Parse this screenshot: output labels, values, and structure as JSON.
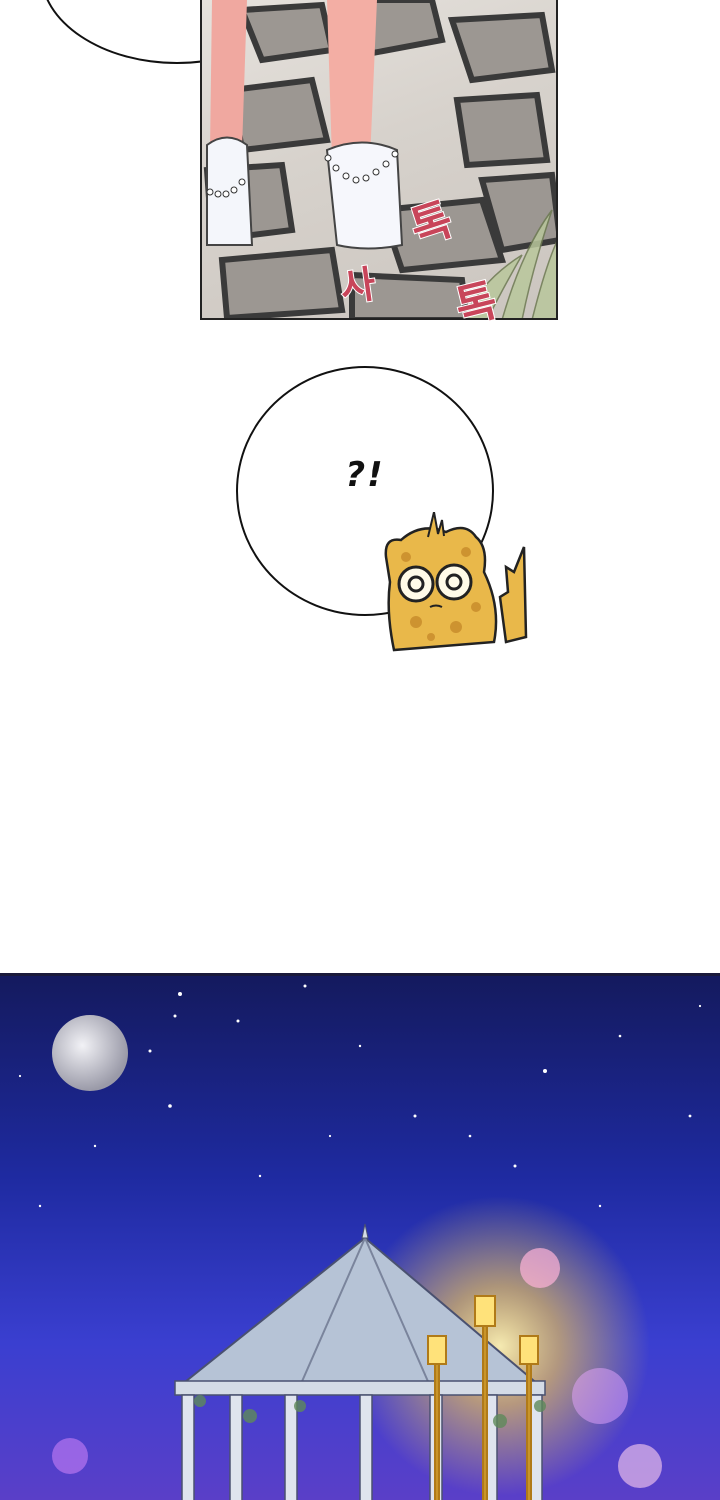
{
  "sound_effects": {
    "sa": "사",
    "tok_1": "톡",
    "tok_2": "톡"
  },
  "speech_bubble": {
    "text": "?!"
  },
  "colors": {
    "sfx": "#c8455a",
    "night_sky": "#1e2aa0",
    "lamp_glow": "#ffd24a",
    "critter": "#e9b84a"
  }
}
